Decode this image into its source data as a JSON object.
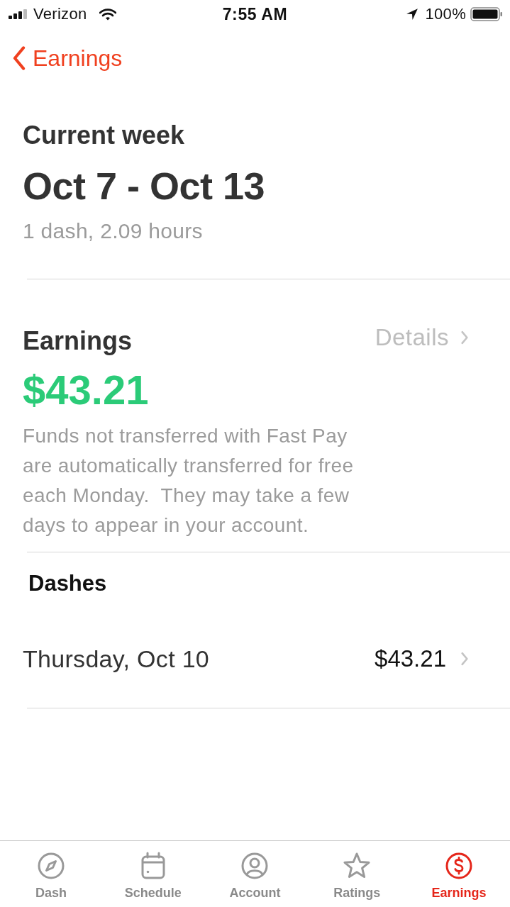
{
  "status_bar": {
    "carrier": "Verizon",
    "time": "7:55 AM",
    "battery": "100%"
  },
  "nav": {
    "back_label": "Earnings"
  },
  "week": {
    "heading": "Current week",
    "range": "Oct 7 - Oct 13",
    "summary": "1 dash, 2.09 hours"
  },
  "earnings": {
    "title": "Earnings",
    "details_link": "Details",
    "amount": "$43.21",
    "note": "Funds not transferred with Fast Pay are automatically transferred for free each Monday.  They may take a few days to appear in your account."
  },
  "dashes": {
    "title": "Dashes",
    "rows": [
      {
        "date": "Thursday, Oct 10",
        "amount": "$43.21"
      }
    ]
  },
  "tab_bar": [
    {
      "label": "Dash",
      "selected": false
    },
    {
      "label": "Schedule",
      "selected": false
    },
    {
      "label": "Account",
      "selected": false
    },
    {
      "label": "Ratings",
      "selected": false
    },
    {
      "label": "Earnings",
      "selected": true
    }
  ]
}
